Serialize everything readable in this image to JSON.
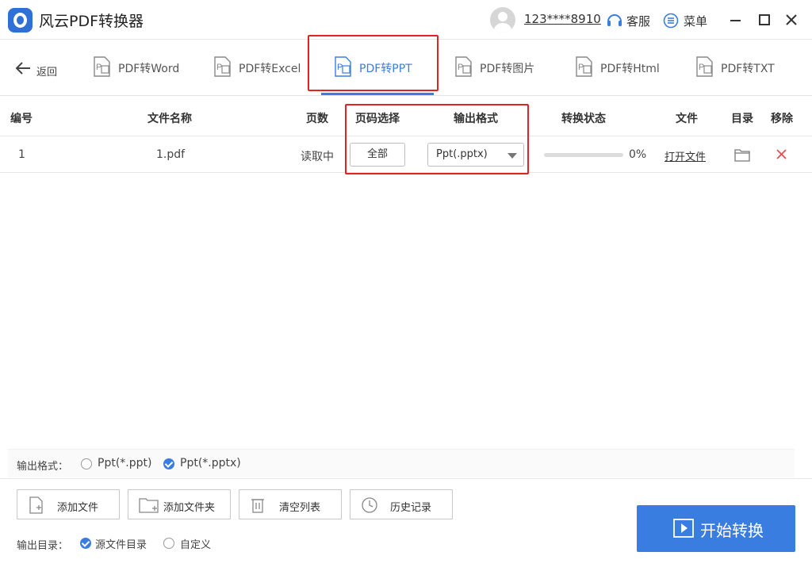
{
  "app": {
    "title": "风云PDF转换器",
    "account": "123****8910",
    "service_label": "客服",
    "menu_label": "菜单"
  },
  "toolbar": {
    "back_label": "返回",
    "tools": [
      {
        "label": "PDF转Word",
        "icon": "pdf-word-icon"
      },
      {
        "label": "PDF转Excel",
        "icon": "pdf-excel-icon"
      },
      {
        "label": "PDF转PPT",
        "icon": "pdf-ppt-icon",
        "active": true
      },
      {
        "label": "PDF转图片",
        "icon": "pdf-image-icon"
      },
      {
        "label": "PDF转Html",
        "icon": "pdf-html-icon"
      },
      {
        "label": "PDF转TXT",
        "icon": "pdf-txt-icon"
      }
    ]
  },
  "table": {
    "headers": {
      "no": "编号",
      "name": "文件名称",
      "pages": "页数",
      "page_select": "页码选择",
      "format": "输出格式",
      "status": "转换状态",
      "file": "文件",
      "dir": "目录",
      "remove": "移除"
    },
    "rows": [
      {
        "no": "1",
        "name": "1.pdf",
        "pages": "读取中",
        "page_select": "全部",
        "format": "Ppt(.pptx)",
        "progress": 0,
        "progress_text": "0%",
        "open_file": "打开文件"
      }
    ]
  },
  "output_format": {
    "label": "输出格式：",
    "options": [
      "Ppt(*.ppt)",
      "Ppt(*.pptx)"
    ],
    "selected": "Ppt(*.pptx)"
  },
  "actions": {
    "add_file": "添加文件",
    "add_folder": "添加文件夹",
    "clear_list": "清空列表",
    "history": "历史记录"
  },
  "output_dir": {
    "label": "输出目录：",
    "options": [
      "源文件目录",
      "自定义"
    ],
    "selected": "源文件目录"
  },
  "start_button": "开始转换",
  "colors": {
    "accent": "#3a7de0",
    "highlight": "#e02424"
  }
}
